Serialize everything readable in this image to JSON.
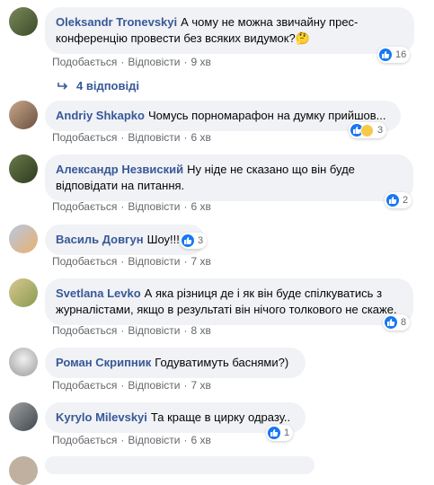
{
  "comments": [
    {
      "author": "Oleksandr Tronevskyi",
      "text": "А чому не можна звичайну прес-конференцію провести без всяких видумок?🤔",
      "like_label": "Подобається",
      "reply_label": "Відповісти",
      "time": "9 хв",
      "reactions": "16",
      "replies": "4 відповіді"
    },
    {
      "author": "Andriy Shkapko",
      "text": "Чомусь порномарафон на думку прийшов...",
      "like_label": "Подобається",
      "reply_label": "Відповісти",
      "time": "6 хв",
      "reactions": "3"
    },
    {
      "author": "Александр Незвиский",
      "text": "Ну ніде не сказано що він буде відповідати на питання.",
      "like_label": "Подобається",
      "reply_label": "Відповісти",
      "time": "6 хв",
      "reactions": "2"
    },
    {
      "author": "Василь Довгун",
      "text": "Шоу!!!",
      "like_label": "Подобається",
      "reply_label": "Відповісти",
      "time": "7 хв",
      "reactions": "3"
    },
    {
      "author": "Svetlana Levko",
      "text": "А яка різниця де і як він буде спілкуватись з журналістами, якщо в результаті він нічого толкового не скаже.",
      "like_label": "Подобається",
      "reply_label": "Відповісти",
      "time": "8 хв",
      "reactions": "8"
    },
    {
      "author": "Роман Скрипник",
      "text": "Годуватимуть баснями?)",
      "like_label": "Подобається",
      "reply_label": "Відповісти",
      "time": "7 хв"
    },
    {
      "author": "Kyrylo Milevskyi",
      "text": "Та краще в цирку одразу..",
      "like_label": "Подобається",
      "reply_label": "Відповісти",
      "time": "6 хв",
      "reactions": "1"
    }
  ],
  "colors": {
    "author": "#385898",
    "bubble": "#f0f2f5",
    "like": "#1877f2",
    "meta": "#65676b"
  }
}
